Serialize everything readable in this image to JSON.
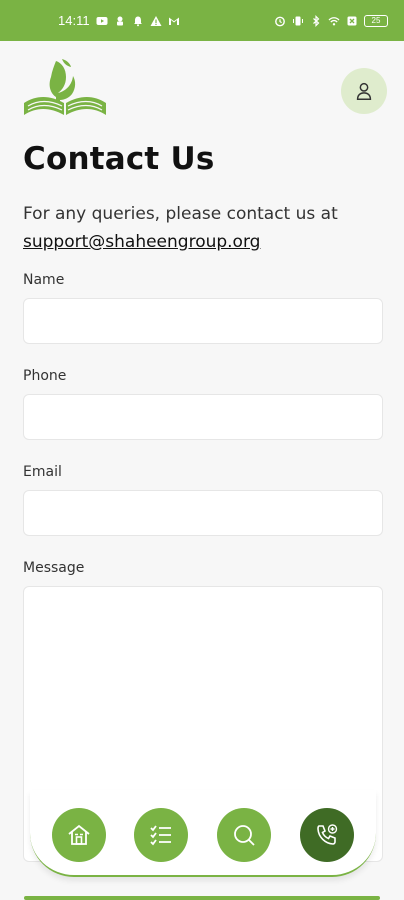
{
  "status_bar": {
    "time": "14:11",
    "battery": "25"
  },
  "page": {
    "title": "Contact Us",
    "intro_text": "For any queries, please contact us at",
    "support_email": "support@shaheengroup.org"
  },
  "form": {
    "name_label": "Name",
    "phone_label": "Phone",
    "email_label": "Email",
    "message_label": "Message",
    "name_value": "",
    "phone_value": "",
    "email_value": "",
    "message_value": ""
  },
  "nav": {
    "items": [
      {
        "icon": "home-icon",
        "active": false
      },
      {
        "icon": "checklist-icon",
        "active": false
      },
      {
        "icon": "search-icon",
        "active": false
      },
      {
        "icon": "phone-add-icon",
        "active": true
      }
    ]
  },
  "colors": {
    "brand_green": "#7ab344",
    "active_green": "#3f6b25",
    "avatar_bg": "#dfeccd"
  }
}
